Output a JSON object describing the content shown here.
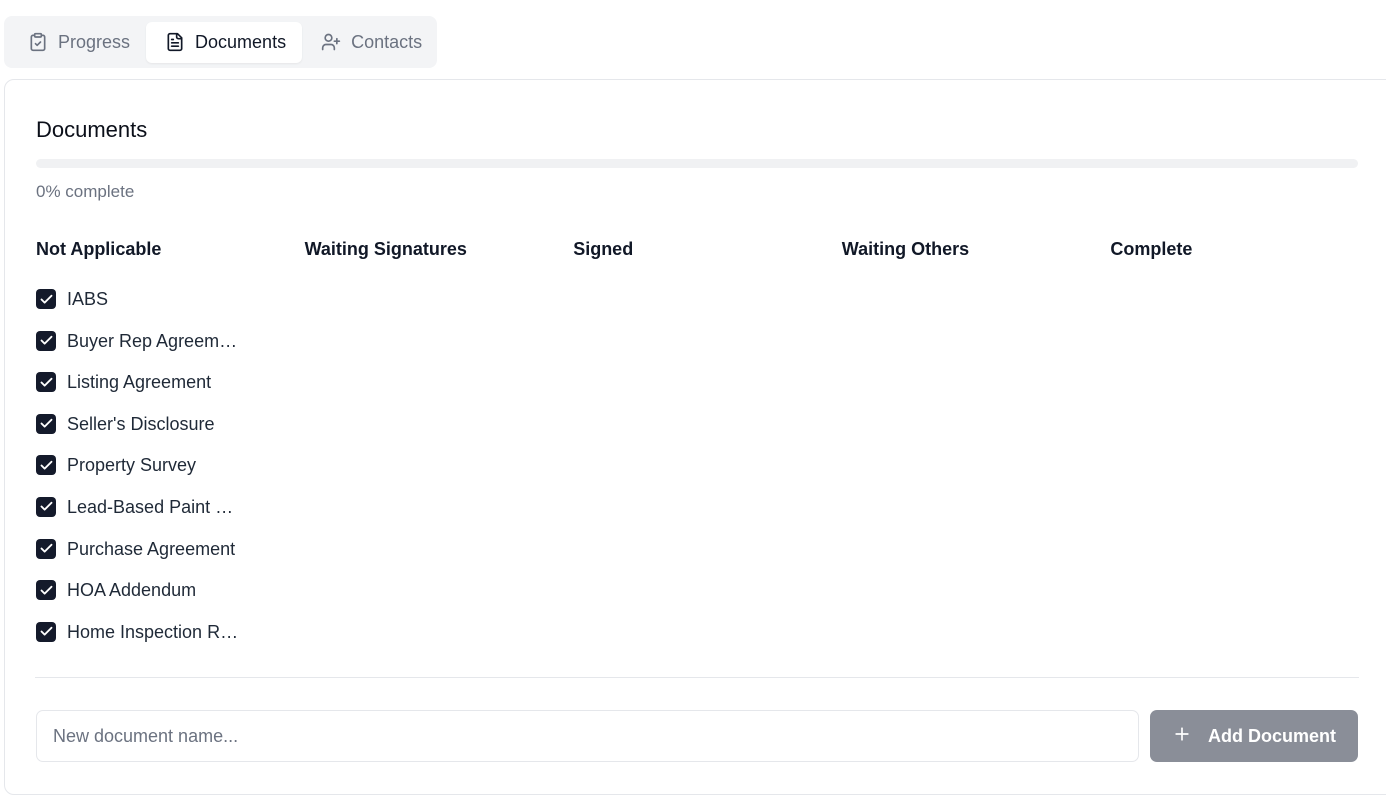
{
  "tabs": [
    {
      "label": "Progress",
      "icon": "clipboard-check-icon",
      "active": false
    },
    {
      "label": "Documents",
      "icon": "file-text-icon",
      "active": true
    },
    {
      "label": "Contacts",
      "icon": "user-plus-icon",
      "active": false
    }
  ],
  "card": {
    "title": "Documents",
    "progress_percent": 0,
    "progress_text": "0% complete"
  },
  "columns": [
    {
      "header": "Not Applicable",
      "items": [
        "IABS",
        "Buyer Rep Agreement",
        "Listing Agreement",
        "Seller's Disclosure",
        "Property Survey",
        "Lead-Based Paint Disclosure",
        "Purchase Agreement",
        "HOA Addendum",
        "Home Inspection Report"
      ]
    },
    {
      "header": "Waiting Signatures",
      "items": []
    },
    {
      "header": "Signed",
      "items": []
    },
    {
      "header": "Waiting Others",
      "items": []
    },
    {
      "header": "Complete",
      "items": []
    }
  ],
  "new_document": {
    "placeholder": "New document name...",
    "value": "",
    "button_label": "Add Document"
  },
  "colors": {
    "checkbox": "#141a2b",
    "button_disabled": "#8a8e98"
  }
}
